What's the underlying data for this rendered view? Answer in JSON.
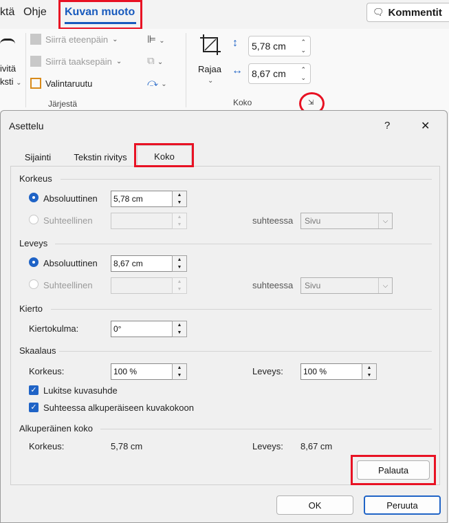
{
  "ribbon": {
    "tabs": [
      "ktä",
      "Ohje",
      "Kuvan muoto"
    ],
    "active_tab": "Kuvan muoto",
    "comment_button": "Kommentit",
    "left_labels": [
      "ivitä",
      "ksti"
    ],
    "arrange": {
      "forward": "Siirrä eteenpäin",
      "backward": "Siirrä taaksepäin",
      "selection_pane": "Valintaruutu",
      "group_label": "Järjestä"
    },
    "size": {
      "crop": "Rajaa",
      "height": "5,78 cm",
      "width": "8,67 cm",
      "group_label": "Koko"
    },
    "accent": "#185abd",
    "highlight": "#e81123"
  },
  "dialog": {
    "title": "Asettelu",
    "help": "?",
    "close": "✕",
    "tabs": [
      "Sijainti",
      "Tekstin rivitys",
      "Koko"
    ],
    "active_tab": "Koko",
    "height": {
      "heading": "Korkeus",
      "absolute_label": "Absoluuttinen",
      "absolute_value": "5,78 cm",
      "relative_label": "Suhteellinen",
      "relative_value": "",
      "relative_to_label": "suhteessa",
      "relative_to_value": "Sivu"
    },
    "width": {
      "heading": "Leveys",
      "absolute_label": "Absoluuttinen",
      "absolute_value": "8,67 cm",
      "relative_label": "Suhteellinen",
      "relative_value": "",
      "relative_to_label": "suhteessa",
      "relative_to_value": "Sivu"
    },
    "rotate": {
      "heading": "Kierto",
      "angle_label": "Kiertokulma:",
      "angle_value": "0°"
    },
    "scale": {
      "heading": "Skaalaus",
      "height_label": "Korkeus:",
      "height_value": "100  %",
      "width_label": "Leveys:",
      "width_value": "100  %",
      "lock_aspect": "Lukitse kuvasuhde",
      "relative_original": "Suhteessa alkuperäiseen kuvakokoon"
    },
    "original": {
      "heading": "Alkuperäinen koko",
      "height_label": "Korkeus:",
      "height_value": "5,78 cm",
      "width_label": "Leveys:",
      "width_value": "8,67 cm"
    },
    "reset_button": "Palauta",
    "ok_button": "OK",
    "cancel_button": "Peruuta"
  }
}
